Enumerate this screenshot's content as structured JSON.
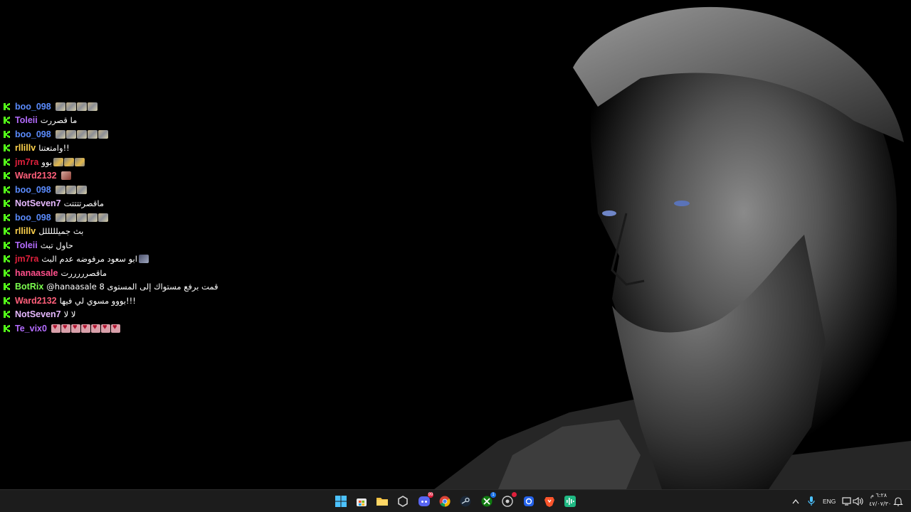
{
  "colors": {
    "kick_green": "#53fc18",
    "taskbar_bg": "#1c1c1c",
    "desktop_bg": "#000000"
  },
  "chat": {
    "messages": [
      {
        "user": "boo_098",
        "color": "#5b8cff",
        "text": "",
        "emotes": 4,
        "emote_style": "default"
      },
      {
        "user": "Toleii",
        "color": "#b46cff",
        "text": "ما قصررت",
        "emotes": 0
      },
      {
        "user": "boo_098",
        "color": "#5b8cff",
        "text": "",
        "emotes": 5,
        "emote_style": "default"
      },
      {
        "user": "rllillv",
        "color": "#ffd34d",
        "text": "وامتعتنا!!",
        "emotes": 0
      },
      {
        "user": "jm7ra",
        "color": "#e0203c",
        "text": "بوو",
        "emotes": 3,
        "emote_style": "gold"
      },
      {
        "user": "Ward2132",
        "color": "#ff5f7a",
        "text": "",
        "emotes": 1,
        "emote_style": "face"
      },
      {
        "user": "boo_098",
        "color": "#5b8cff",
        "text": "",
        "emotes": 3,
        "emote_style": "default"
      },
      {
        "user": "NotSeven7",
        "color": "#e6b8ff",
        "text": "ماقصرتتتتت",
        "emotes": 0
      },
      {
        "user": "boo_098",
        "color": "#5b8cff",
        "text": "",
        "emotes": 5,
        "emote_style": "default"
      },
      {
        "user": "rllillv",
        "color": "#ffd34d",
        "text": "بث جميلللللل",
        "emotes": 0
      },
      {
        "user": "Toleii",
        "color": "#b46cff",
        "text": "حاول تبث",
        "emotes": 0
      },
      {
        "user": "jm7ra",
        "color": "#e0203c",
        "text": "ابو سعود مرفوضه عدم البث",
        "emotes": 1,
        "emote_style": "dark"
      },
      {
        "user": "hanaasale",
        "color": "#ff4f8b",
        "text": "ماقصرررررت",
        "emotes": 0
      },
      {
        "user": "BotRix",
        "color": "#7cff4f",
        "text": "@hanaasale قمت برفع مستواك إلى المستوى 8",
        "emotes": 0
      },
      {
        "user": "Ward2132",
        "color": "#ff5f7a",
        "text": "بووو مسوي لي فيها!!!",
        "emotes": 0
      },
      {
        "user": "NotSeven7",
        "color": "#e6b8ff",
        "text": "لا لا",
        "emotes": 0
      },
      {
        "user": "Te_vix0",
        "color": "#b46cff",
        "text": "",
        "emotes": 7,
        "emote_style": "heart"
      }
    ]
  },
  "taskbar": {
    "pinned": [
      {
        "name": "start-button",
        "icon": "windows-logo-icon"
      },
      {
        "name": "microsoft-store-button",
        "icon": "store-icon"
      },
      {
        "name": "file-explorer-button",
        "icon": "folder-icon"
      },
      {
        "name": "app-button",
        "icon": "hexagon-icon"
      },
      {
        "name": "discord-button",
        "icon": "discord-icon",
        "badge": "99"
      },
      {
        "name": "chrome-button",
        "icon": "chrome-icon"
      },
      {
        "name": "steam-button",
        "icon": "steam-icon"
      },
      {
        "name": "xbox-button",
        "icon": "xbox-icon",
        "badge": "1"
      },
      {
        "name": "obs-button",
        "icon": "record-icon"
      },
      {
        "name": "app-blue-button",
        "icon": "blue-app-icon"
      },
      {
        "name": "brave-button",
        "icon": "brave-icon"
      },
      {
        "name": "audio-app-button",
        "icon": "waveform-icon"
      }
    ],
    "tray": {
      "language": "ENG",
      "time": "٦:٢٨ م",
      "date": "٤٧/٠٧/٣٠"
    }
  }
}
